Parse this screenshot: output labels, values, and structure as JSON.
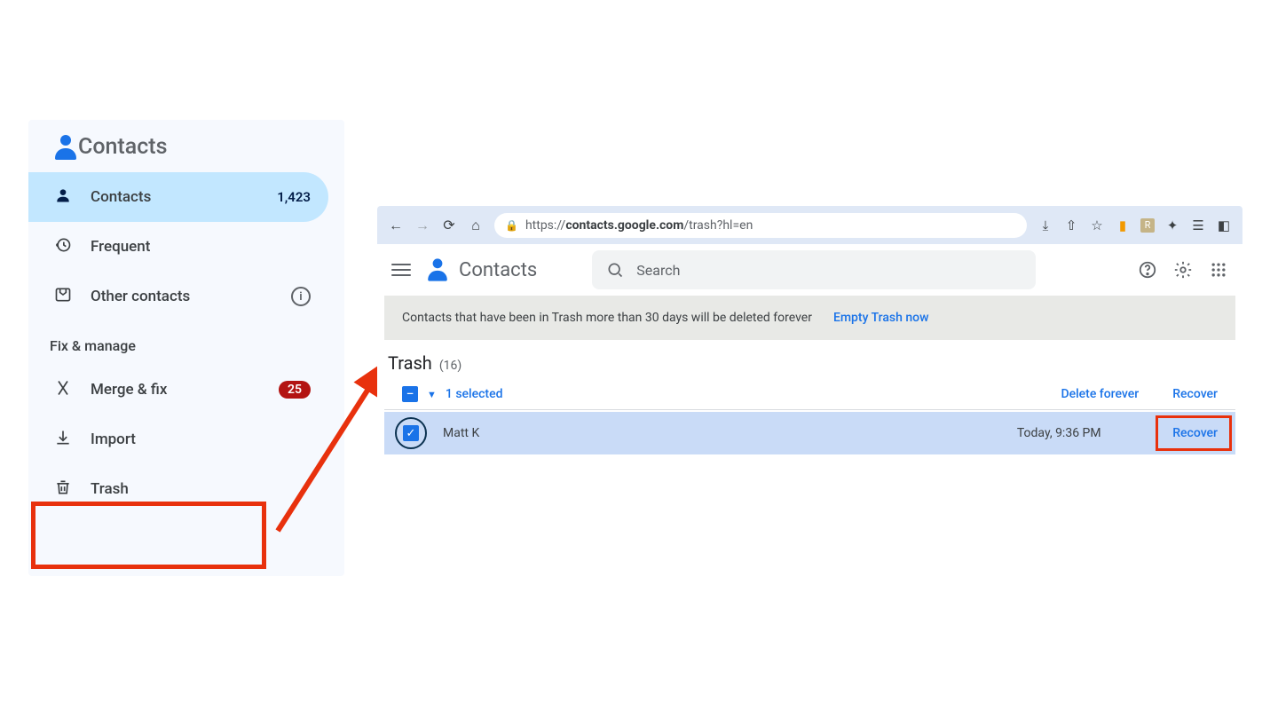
{
  "sidebar": {
    "app_title": "Contacts",
    "items": [
      {
        "label": "Contacts",
        "count": "1,423"
      },
      {
        "label": "Frequent"
      },
      {
        "label": "Other contacts"
      }
    ],
    "section_label": "Fix & manage",
    "manage": [
      {
        "label": "Merge & fix",
        "badge": "25"
      },
      {
        "label": "Import"
      },
      {
        "label": "Trash"
      }
    ]
  },
  "browser": {
    "url_display_prefix": "https://",
    "url_host": "contacts.google.com",
    "url_path": "/trash?hl=en"
  },
  "app": {
    "title": "Contacts",
    "search_placeholder": "Search"
  },
  "banner": {
    "text": "Contacts that have been in Trash more than 30 days will be deleted forever",
    "link": "Empty Trash now"
  },
  "trash": {
    "title": "Trash",
    "count": "(16)",
    "selected_label": "1 selected",
    "delete_forever": "Delete forever",
    "recover": "Recover"
  },
  "rows": [
    {
      "name": "Matt K",
      "time": "Today, 9:36 PM",
      "action": "Recover"
    }
  ]
}
